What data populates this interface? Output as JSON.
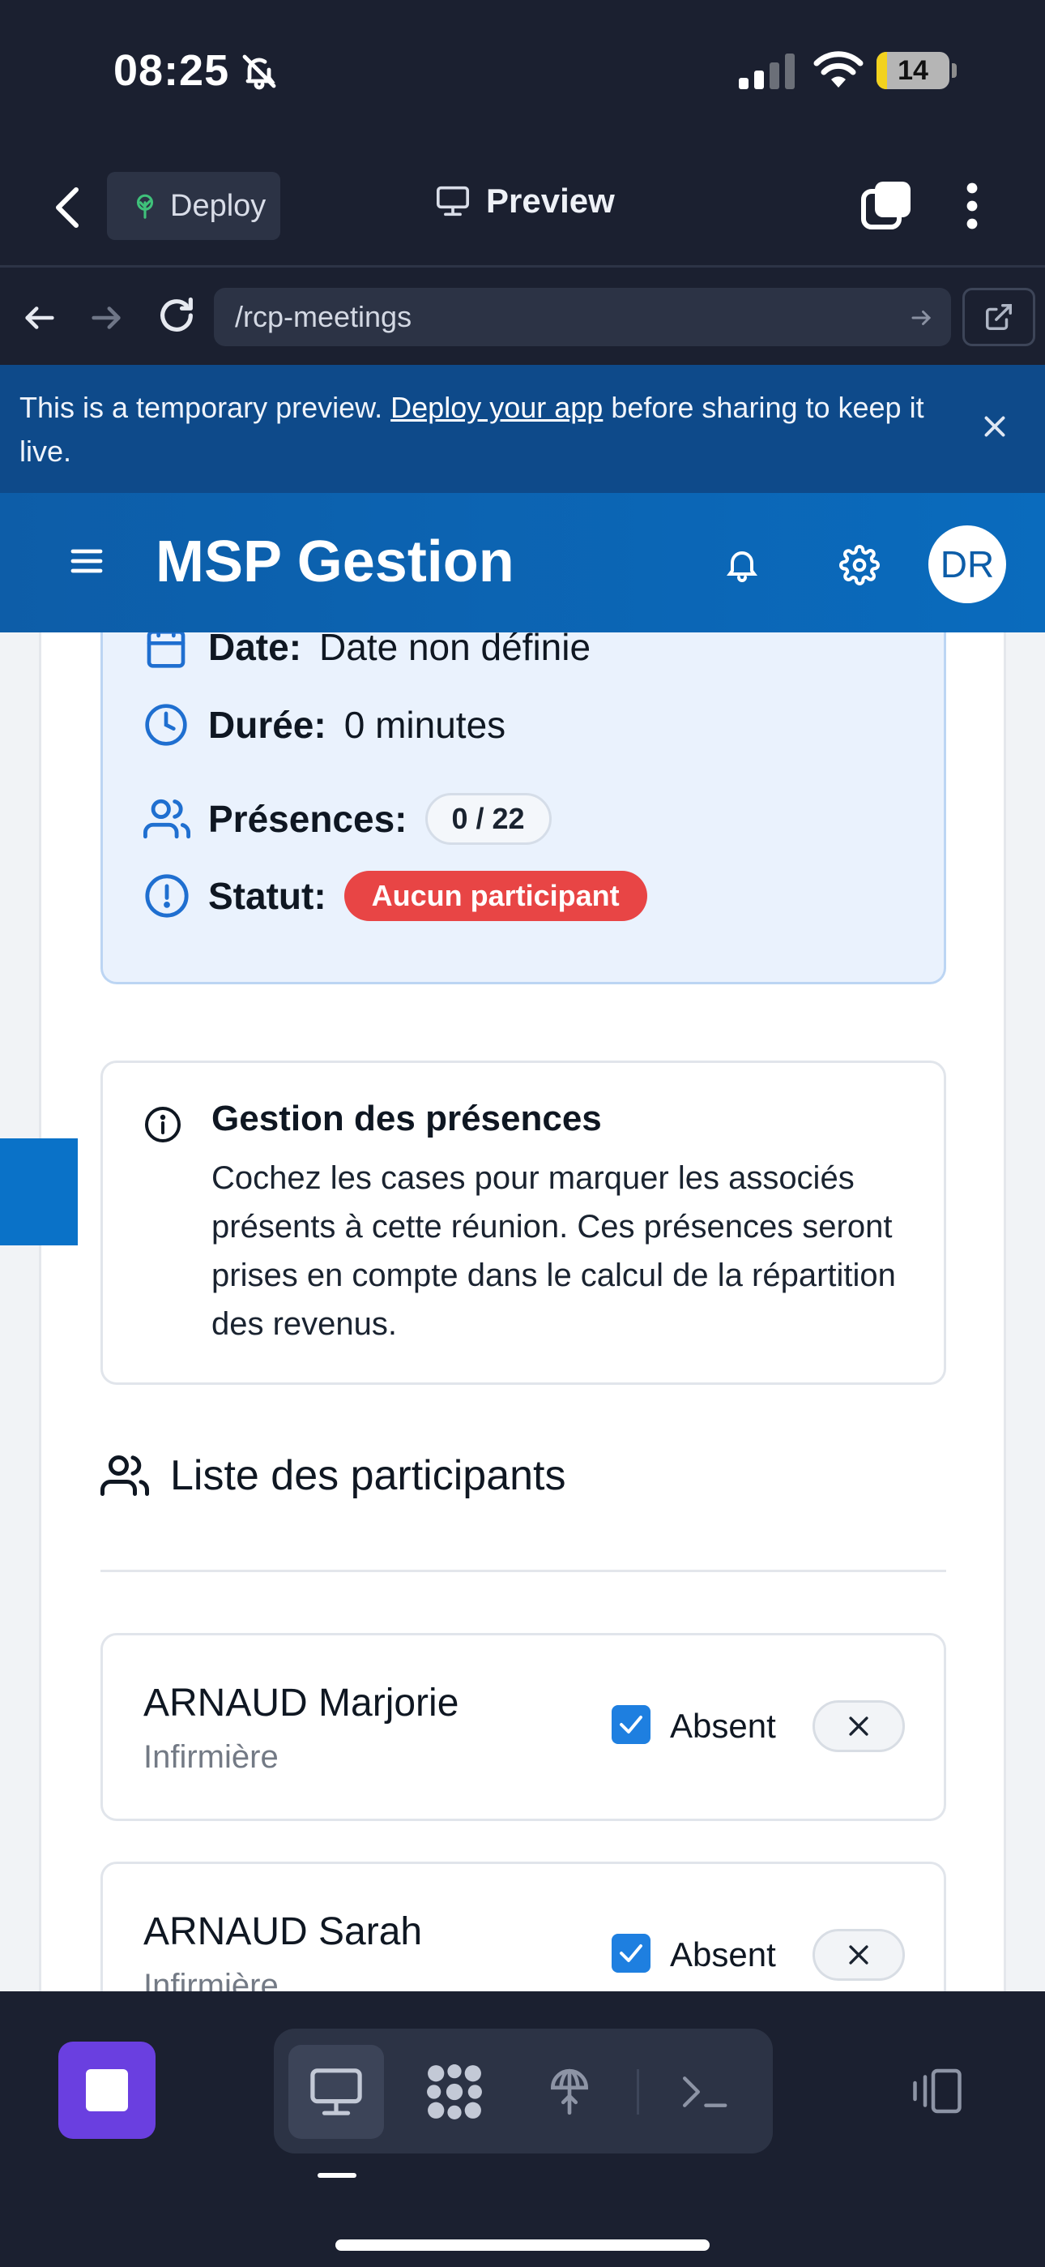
{
  "status": {
    "time": "08:25",
    "battery": "14",
    "battery_level": 0.14
  },
  "app_header": {
    "deploy_label": "Deploy",
    "preview_label": "Preview"
  },
  "browser": {
    "url": "/rcp-meetings"
  },
  "banner": {
    "text_before": "This is a temporary preview. ",
    "link": "Deploy your app",
    "text_after": " before sharing to keep it live."
  },
  "header": {
    "title": "MSP Gestion",
    "avatar_initials": "DR"
  },
  "summary": {
    "date_label": "Date:",
    "date_value": "Date non définie",
    "duration_label": "Durée:",
    "duration_value": "0 minutes",
    "presence_label": "Présences:",
    "presence_value": "0 / 22",
    "status_label": "Statut:",
    "status_value": "Aucun participant"
  },
  "notice": {
    "title": "Gestion des présences",
    "body": "Cochez les cases pour marquer les associés présents à cette réunion. Ces présences seront prises en compte dans le calcul de la répartition des revenus."
  },
  "participants": {
    "title": "Liste des participants",
    "items": [
      {
        "name": "ARNAUD Marjorie",
        "role": "Infirmière",
        "status": "Absent",
        "checked": true
      },
      {
        "name": "ARNAUD Sarah",
        "role": "Infirmière",
        "status": "Absent",
        "checked": true
      }
    ]
  },
  "colors": {
    "brand": "#0d5da8",
    "status_red": "#e84545",
    "checkbox_blue": "#1e7fe0",
    "stop_purple": "#6a3fe0"
  },
  "icons": [
    "bell-off-icon",
    "signal-icon",
    "wifi-icon",
    "chevron-left-icon",
    "tree-icon",
    "monitor-icon",
    "tabs-icon",
    "kebab-icon",
    "arrow-left-icon",
    "arrow-right-icon",
    "reload-icon",
    "external-link-icon",
    "close-icon",
    "menu-icon",
    "bell-icon",
    "gear-icon",
    "calendar-icon",
    "clock-icon",
    "users-icon",
    "alert-circle-icon",
    "info-icon",
    "check-icon",
    "x-icon",
    "stop-icon",
    "desktop-icon",
    "apps-icon",
    "globe-icon",
    "terminal-icon",
    "devices-icon"
  ]
}
